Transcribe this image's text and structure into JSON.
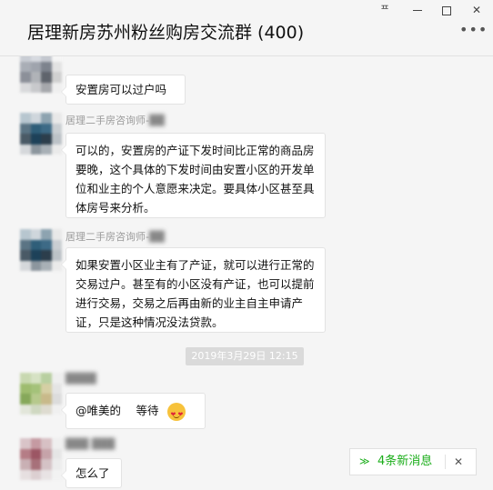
{
  "window": {
    "title": "居理新房苏州粉丝购房交流群 (400)",
    "pin_icon": "pin-icon",
    "min_icon": "minimize-icon",
    "max_icon": "maximize-icon",
    "close_icon": "close-icon",
    "more_label": "•••",
    "pin_glyph": "ᄑ",
    "close_glyph": "✕"
  },
  "messages": [
    {
      "sender": "",
      "text": "安置房可以过户吗"
    },
    {
      "sender": "居理二手房咨询师-",
      "text": "可以的，安置房的产证下发时间比正常的商品房要晚，这个具体的下发时间由安置小区的开发单位和业主的个人意愿来决定。要具体小区甚至具体房号来分析。"
    },
    {
      "sender": "居理二手房咨询师-",
      "text": "如果安置小区业主有了产证，就可以进行正常的交易过户。甚至有的小区没有产证，也可以提前进行交易，交易之后再由新的业主自主申请产证，只是这种情况没法贷款。"
    },
    {
      "sender": "",
      "text": "@唯美的　 等待"
    },
    {
      "sender": "",
      "text": "怎么了"
    }
  ],
  "timestamp": "2019年3月29日 12:15",
  "new_messages": {
    "chevron": "≫",
    "label": "4条新消息",
    "close": "✕"
  },
  "colors": {
    "accent": "#1aad19",
    "timestamp_bg": "#dadada"
  }
}
